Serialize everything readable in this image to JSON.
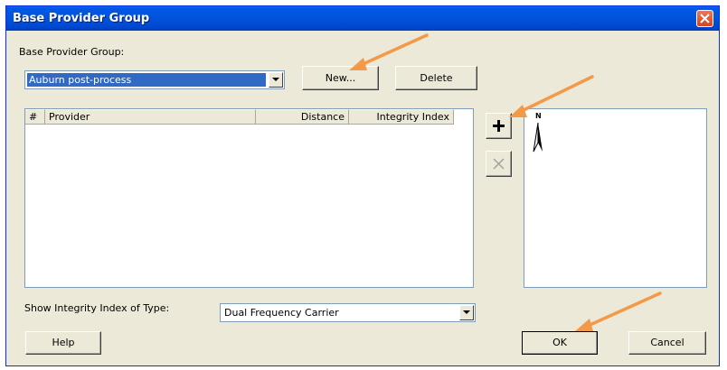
{
  "window": {
    "title": "Base Provider Group"
  },
  "group": {
    "label": "Base Provider Group:",
    "selected": "Auburn post-process",
    "new_label": "New...",
    "delete_label": "Delete"
  },
  "table": {
    "columns": [
      "#",
      "Provider",
      "Distance",
      "Integrity Index"
    ],
    "rows": []
  },
  "side": {
    "add_icon": "plus-icon",
    "remove_icon": "x-icon"
  },
  "map": {
    "north_label": "N",
    "north_icon": "north-arrow-icon"
  },
  "integrity": {
    "label": "Show Integrity Index of Type:",
    "selected": "Dual Frequency Carrier"
  },
  "footer": {
    "help_label": "Help",
    "ok_label": "OK",
    "cancel_label": "Cancel"
  },
  "colors": {
    "titlebar": "#0054e3",
    "dialog_bg": "#ece9d8",
    "selection": "#316ac5",
    "annotation_arrow": "#f39a4a"
  }
}
